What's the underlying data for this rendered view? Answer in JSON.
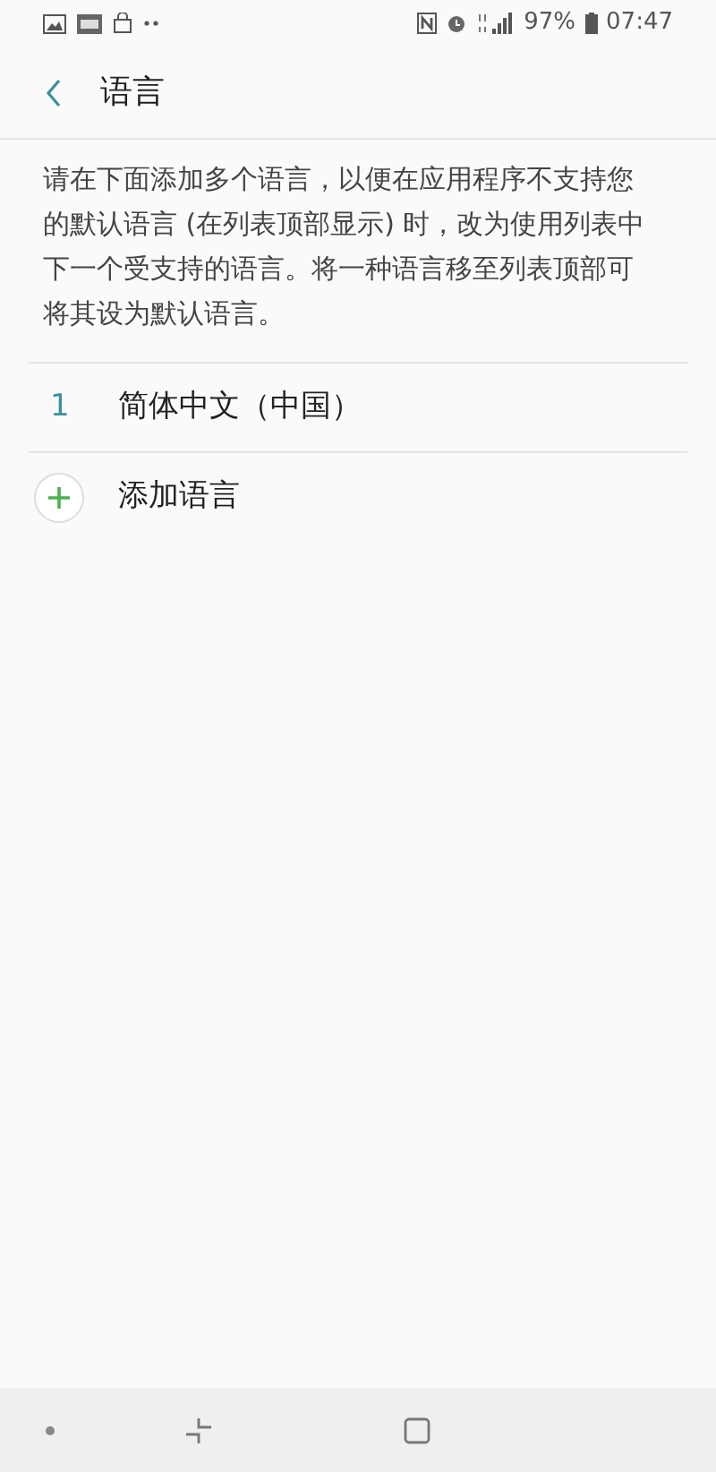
{
  "status_bar": {
    "battery": "97%",
    "time": "07:47"
  },
  "header": {
    "title": "语言"
  },
  "description": "请在下面添加多个语言，以便在应用程序不支持您的默认语言 (在列表顶部显示) 时，改为使用列表中下一个受支持的语言。将一种语言移至列表顶部可将其设为默认语言。",
  "languages": [
    {
      "index": "1",
      "name": "简体中文（中国）"
    }
  ],
  "add_language": {
    "label": "添加语言"
  }
}
